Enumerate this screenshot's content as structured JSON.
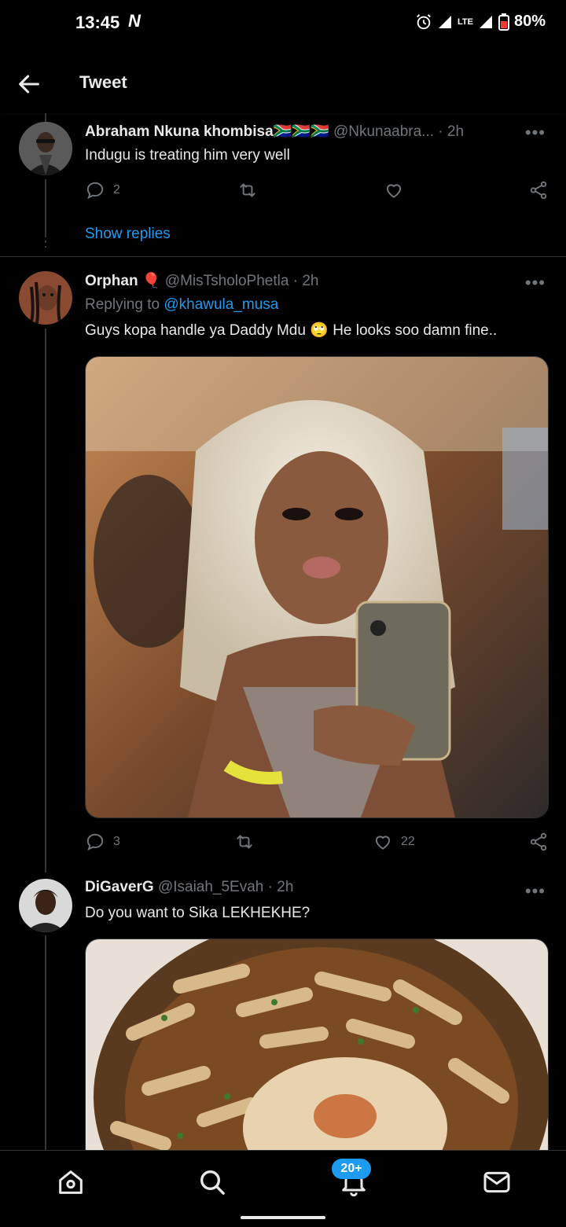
{
  "status_bar": {
    "time": "13:45",
    "notification_icon": "N",
    "network": "LTE",
    "battery": "80%"
  },
  "app_bar": {
    "back_icon": "arrow-left-icon",
    "title": "Tweet"
  },
  "tweets": [
    {
      "name": "Abraham Nkuna khombisa",
      "flags": "🇿🇦🇿🇦🇿🇦",
      "handle": "@Nkunaabra...",
      "time": "· 2h",
      "text": "Indugu is treating him very well",
      "replies": "2",
      "retweets": "",
      "likes": "",
      "show_replies": "Show replies"
    },
    {
      "name": "Orphan",
      "badge": "🎈",
      "handle": "@MisTsholoPhetla",
      "time": "· 2h",
      "replying_prefix": "Replying to",
      "replying_to": "@khawula_musa",
      "text": "Guys kopa handle ya Daddy Mdu",
      "emoji": "🙄",
      "text2": "He looks soo damn fine..",
      "replies": "3",
      "retweets": "",
      "likes": "22"
    },
    {
      "name": "DiGaverG",
      "handle": "@Isaiah_5Evah",
      "time": "· 2h",
      "text": "Do you want to Sika LEKHEKHE?"
    }
  ],
  "more_label": "•••",
  "bottom_nav": {
    "notification_badge": "20+"
  },
  "colors": {
    "accent": "#1d9bf0",
    "background": "#000000",
    "muted": "#71767b"
  }
}
